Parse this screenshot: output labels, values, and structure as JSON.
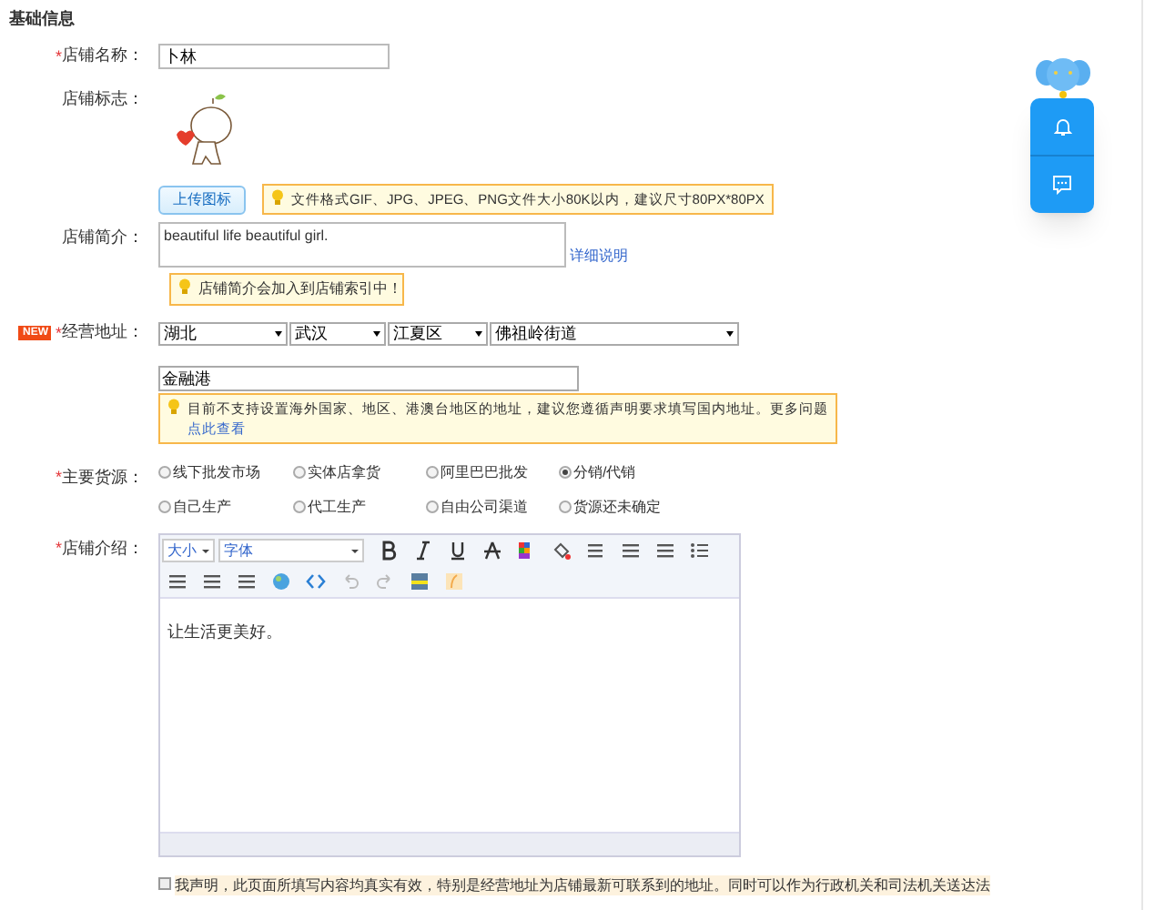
{
  "section_title": "基础信息",
  "shop_name": {
    "label": "店铺名称：",
    "required_mark": "*",
    "value": "卜林"
  },
  "shop_logo": {
    "label": "店铺标志：",
    "upload_button": "上传图标",
    "tip": "文件格式GIF、JPG、JPEG、PNG文件大小80K以内，建议尺寸80PX*80PX"
  },
  "shop_intro": {
    "label": "店铺简介：",
    "value": "beautiful life  beautiful girl.",
    "link": "详细说明",
    "tip": "店铺简介会加入到店铺索引中！"
  },
  "address": {
    "badge": "NEW",
    "label": "经营地址：",
    "required_mark": "*",
    "selects": [
      "湖北",
      "武汉",
      "江夏区",
      "佛祖岭街道"
    ],
    "detail": "金融港",
    "tip": "目前不支持设置海外国家、地区、港澳台地区的地址，建议您遵循声明要求填写国内地址。更多问题",
    "tip_link": "点此查看"
  },
  "source": {
    "label": "主要货源：",
    "required_mark": "*",
    "options": [
      {
        "label": "线下批发市场",
        "selected": false
      },
      {
        "label": "实体店拿货",
        "selected": false
      },
      {
        "label": "阿里巴巴批发",
        "selected": false
      },
      {
        "label": "分销/代销",
        "selected": true
      },
      {
        "label": "自己生产",
        "selected": false
      },
      {
        "label": "代工生产",
        "selected": false
      },
      {
        "label": "自由公司渠道",
        "selected": false
      },
      {
        "label": "货源还未确定",
        "selected": false
      }
    ]
  },
  "description": {
    "label": "店铺介绍：",
    "required_mark": "*",
    "size_select": "大小",
    "font_select": "字体",
    "content": "让生活更美好。"
  },
  "declaration": {
    "checked": false,
    "text": "我声明，此页面所填写内容均真实有效，特别是经营地址为店铺最新可联系到的地址。同时可以作为行政机关和司法机关送达法"
  }
}
